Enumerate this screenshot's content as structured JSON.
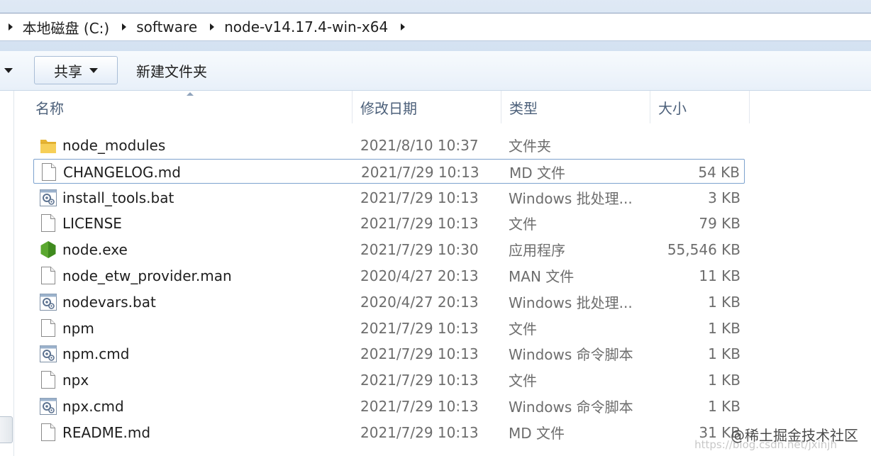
{
  "breadcrumb": {
    "fragment": "ı",
    "items": [
      "本地磁盘 (C:)",
      "software",
      "node-v14.17.4-win-x64"
    ]
  },
  "toolbar": {
    "share_label": "共享",
    "new_folder_label": "新建文件夹"
  },
  "columns": {
    "name": "名称",
    "date": "修改日期",
    "type": "类型",
    "size": "大小"
  },
  "files": [
    {
      "name": "node_modules",
      "date": "2021/8/10 10:37",
      "type": "文件夹",
      "size": "",
      "icon": "folder-icon"
    },
    {
      "name": "CHANGELOG.md",
      "date": "2021/7/29 10:13",
      "type": "MD 文件",
      "size": "54 KB",
      "icon": "file-icon"
    },
    {
      "name": "install_tools.bat",
      "date": "2021/7/29 10:13",
      "type": "Windows 批处理...",
      "size": "3 KB",
      "icon": "batch-file-icon"
    },
    {
      "name": "LICENSE",
      "date": "2021/7/29 10:13",
      "type": "文件",
      "size": "79 KB",
      "icon": "file-icon"
    },
    {
      "name": "node.exe",
      "date": "2021/7/29 10:30",
      "type": "应用程序",
      "size": "55,546 KB",
      "icon": "nodejs-icon"
    },
    {
      "name": "node_etw_provider.man",
      "date": "2020/4/27 20:13",
      "type": "MAN 文件",
      "size": "11 KB",
      "icon": "file-icon"
    },
    {
      "name": "nodevars.bat",
      "date": "2020/4/27 20:13",
      "type": "Windows 批处理...",
      "size": "1 KB",
      "icon": "batch-file-icon"
    },
    {
      "name": "npm",
      "date": "2021/7/29 10:13",
      "type": "文件",
      "size": "1 KB",
      "icon": "file-icon"
    },
    {
      "name": "npm.cmd",
      "date": "2021/7/29 10:13",
      "type": "Windows 命令脚本",
      "size": "1 KB",
      "icon": "batch-file-icon"
    },
    {
      "name": "npx",
      "date": "2021/7/29 10:13",
      "type": "文件",
      "size": "1 KB",
      "icon": "file-icon"
    },
    {
      "name": "npx.cmd",
      "date": "2021/7/29 10:13",
      "type": "Windows 命令脚本",
      "size": "1 KB",
      "icon": "batch-file-icon"
    },
    {
      "name": "README.md",
      "date": "2021/7/29 10:13",
      "type": "MD 文件",
      "size": "31 KB",
      "icon": "file-icon"
    }
  ],
  "focused_index": 1,
  "watermark": {
    "text": "@稀土掘金技术社区",
    "url": "https://blog.csdn.net/jxinjh"
  }
}
